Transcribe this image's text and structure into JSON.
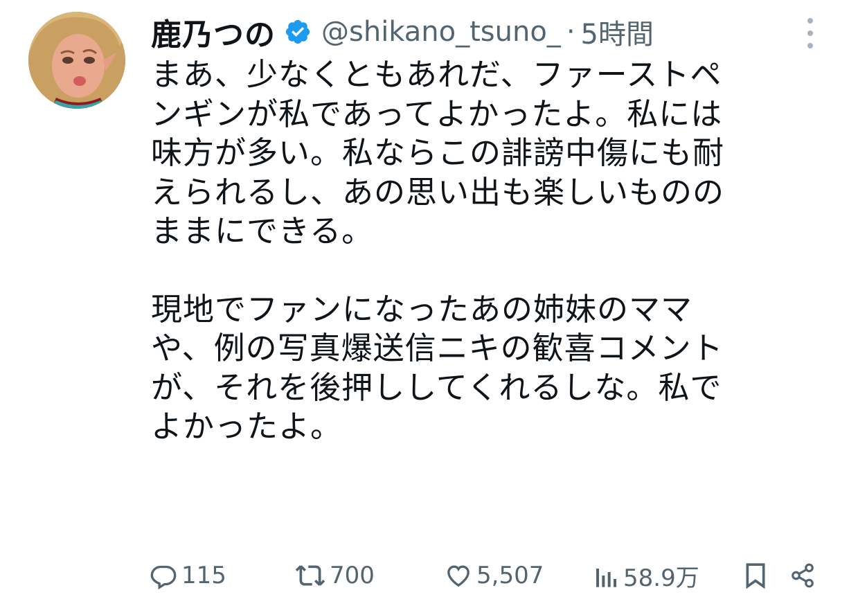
{
  "tweet": {
    "author": {
      "display_name": "鹿乃つの",
      "handle": "@shikano_tsuno_",
      "verified": true
    },
    "separator": "·",
    "timestamp": "5時間",
    "paragraphs": [
      "まあ、少なくともあれだ、ファーストペ\nンギンが私であってよかったよ。私には\n味方が多い。私ならこの誹謗中傷にも耐\nえられるし、あの思い出も楽しいものの\nままにできる。",
      "現地でファンになったあの姉妹のママ\nや、例の写真爆送信ニキの歓喜コメント\nが、それを後押ししてくれるしな。私で\nよかったよ。"
    ]
  },
  "actions": {
    "reply": {
      "icon": "reply-icon",
      "count": "115"
    },
    "retweet": {
      "icon": "retweet-icon",
      "count": "700"
    },
    "like": {
      "icon": "heart-icon",
      "count": "5,507"
    },
    "views": {
      "icon": "views-icon",
      "count": "58.9万"
    },
    "bookmark": {
      "icon": "bookmark-icon"
    },
    "share": {
      "icon": "share-icon"
    }
  },
  "colors": {
    "text": "#0f1419",
    "secondary": "#536471",
    "verified_blue": "#1d9bf0"
  }
}
